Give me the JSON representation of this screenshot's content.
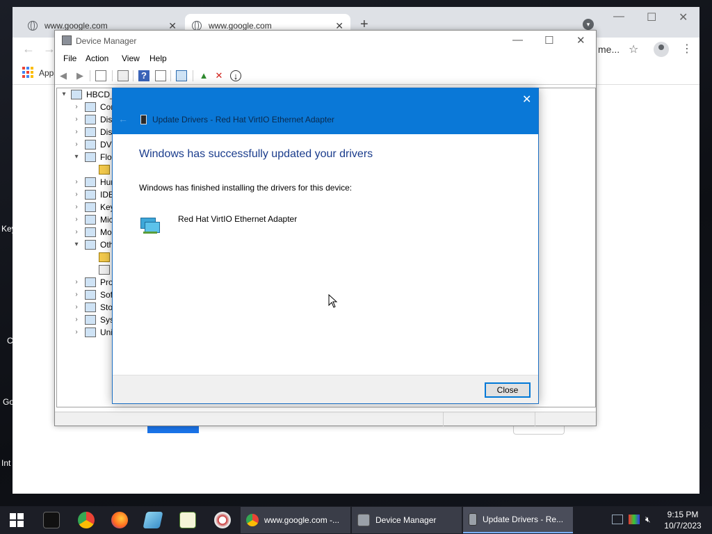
{
  "browser": {
    "tabs": [
      {
        "title": "www.google.com"
      },
      {
        "title": "www.google.com"
      }
    ],
    "new_tab_symbol": "+",
    "omnibox_tail": "me...",
    "bookmarks_bar": {
      "apps_label": "Apps"
    }
  },
  "desktop": {
    "icon_labels": [
      "Key",
      "C",
      "Go",
      "Int"
    ]
  },
  "device_manager": {
    "title": "Device Manager",
    "menu": [
      "File",
      "Action",
      "View",
      "Help"
    ],
    "tree": [
      {
        "label": "HBCD_",
        "expander": "▾"
      },
      {
        "label": "Con",
        "expander": "›"
      },
      {
        "label": "Disk",
        "expander": "›"
      },
      {
        "label": "Disp",
        "expander": "›"
      },
      {
        "label": "DVD",
        "expander": "›"
      },
      {
        "label": "Flop",
        "expander": "▾"
      },
      {
        "label": "",
        "expander": ""
      },
      {
        "label": "Hun",
        "expander": "›"
      },
      {
        "label": "IDE",
        "expander": "›"
      },
      {
        "label": "Key",
        "expander": "›"
      },
      {
        "label": "Mic",
        "expander": "›"
      },
      {
        "label": "Mo",
        "expander": "›"
      },
      {
        "label": "Oth",
        "expander": "▾"
      },
      {
        "label": "",
        "expander": ""
      },
      {
        "label": "",
        "expander": ""
      },
      {
        "label": "Pro",
        "expander": "›"
      },
      {
        "label": "Sof",
        "expander": "›"
      },
      {
        "label": "Sto",
        "expander": "›"
      },
      {
        "label": "Syst",
        "expander": "›"
      },
      {
        "label": "Uni",
        "expander": "›"
      }
    ]
  },
  "dialog": {
    "window_title": "Update Drivers - Red Hat VirtIO Ethernet Adapter",
    "heading": "Windows has successfully updated your drivers",
    "message": "Windows has finished installing the drivers for this device:",
    "device_name": "Red Hat VirtIO Ethernet Adapter",
    "close_button": "Close"
  },
  "taskbar": {
    "tasks": [
      {
        "label": "www.google.com -..."
      },
      {
        "label": "Device Manager"
      },
      {
        "label": "Update Drivers - Re..."
      }
    ],
    "clock": {
      "time": "9:15 PM",
      "date": "10/7/2023"
    }
  },
  "colors": {
    "dialog_header": "#0a78d7",
    "dialog_heading_text": "#1a3c8c",
    "taskbar": "#1c1e26",
    "button_focus_border": "#0078d7"
  }
}
